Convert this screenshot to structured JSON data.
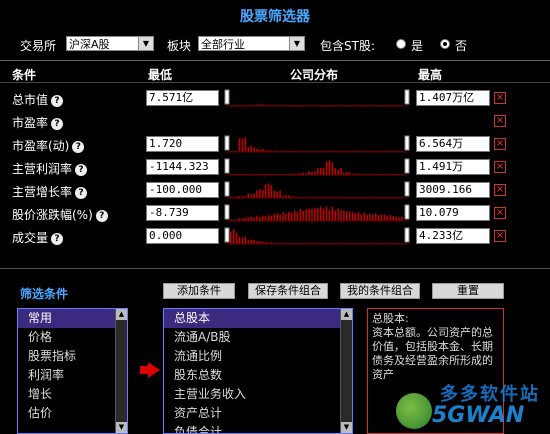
{
  "title": "股票筛选器",
  "toolbar": {
    "exchange_label": "交易所",
    "exchange_value": "沪深A股",
    "sector_label": "板块",
    "sector_value": "全部行业",
    "st_label": "包含ST股:",
    "st_yes": "是",
    "st_no": "否",
    "st_selected": "否"
  },
  "columns": {
    "condition": "条件",
    "min": "最低",
    "dist": "公司分布",
    "max": "最高"
  },
  "rows": [
    {
      "label": "总市值",
      "min": "7.571亿",
      "max": "1.407万亿"
    },
    {
      "label": "市盈率",
      "min": "",
      "max": ""
    },
    {
      "label": "市盈率(动)",
      "min": "1.720",
      "max": "6.564万"
    },
    {
      "label": "主营利润率",
      "min": "-1144.323",
      "max": "1.491万"
    },
    {
      "label": "主营增长率",
      "min": "-100.000",
      "max": "3009.166"
    },
    {
      "label": "股价涨跌幅(%)",
      "min": "-8.739",
      "max": "10.079"
    },
    {
      "label": "成交量",
      "min": "0.000",
      "max": "4.233亿"
    }
  ],
  "help_glyph": "?",
  "remove_glyph": "×",
  "filter": {
    "heading": "筛选条件",
    "buttons": [
      "添加条件",
      "保存条件组合",
      "我的条件组合",
      "重置"
    ]
  },
  "categories": [
    "常用",
    "价格",
    "股票指标",
    "利润率",
    "增长",
    "估价"
  ],
  "fields": [
    "总股本",
    "流通A/B股",
    "流通比例",
    "股东总数",
    "主营业务收入",
    "资产总计",
    "负债合计"
  ],
  "description": "总股本:\n资本总额。公司资产的总价值，包括股本金、长期债务及经营盈余所形成的资产",
  "watermark": {
    "line1": "多多软件站",
    "line2": "5GWAN"
  },
  "colors": {
    "accent": "#4aa8ff",
    "bars": "#c00000",
    "remove": "#e33333"
  }
}
